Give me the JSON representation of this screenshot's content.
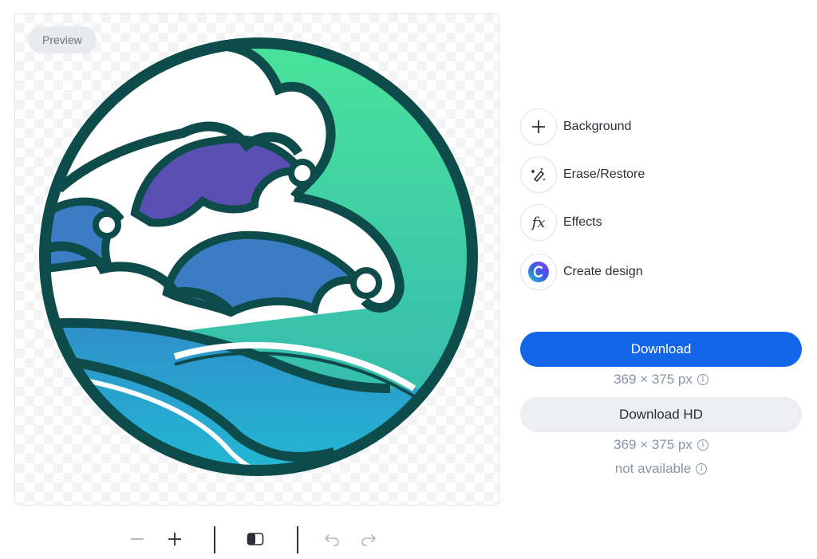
{
  "preview": {
    "badge_label": "Preview",
    "image_description_icon": "ocean-waves-circle-logo"
  },
  "tools": [
    {
      "label": "Background",
      "icon": "plus-icon"
    },
    {
      "label": "Erase/Restore",
      "icon": "magic-eraser-icon"
    },
    {
      "label": "Effects",
      "icon": "fx-icon"
    },
    {
      "label": "Create design",
      "icon": "canva-logo-icon"
    }
  ],
  "download": {
    "label": "Download",
    "size": "369 × 375 px"
  },
  "download_hd": {
    "label": "Download HD",
    "size": "369 × 375 px",
    "availability": "not available"
  },
  "toolbar": {
    "zoom_out_icon": "minus-icon",
    "zoom_in_icon": "plus-icon",
    "compare_icon": "compare-icon",
    "undo_icon": "undo-icon",
    "redo_icon": "redo-icon"
  },
  "colors": {
    "accent": "#1466e8",
    "secondary_button": "#eceef1",
    "muted_text": "#8a94a3",
    "wave_outline": "#0d4c4a",
    "wave_green": "#4fe49a",
    "wave_blue": "#2aa7d6",
    "wave_purple": "#5a4fb3"
  }
}
